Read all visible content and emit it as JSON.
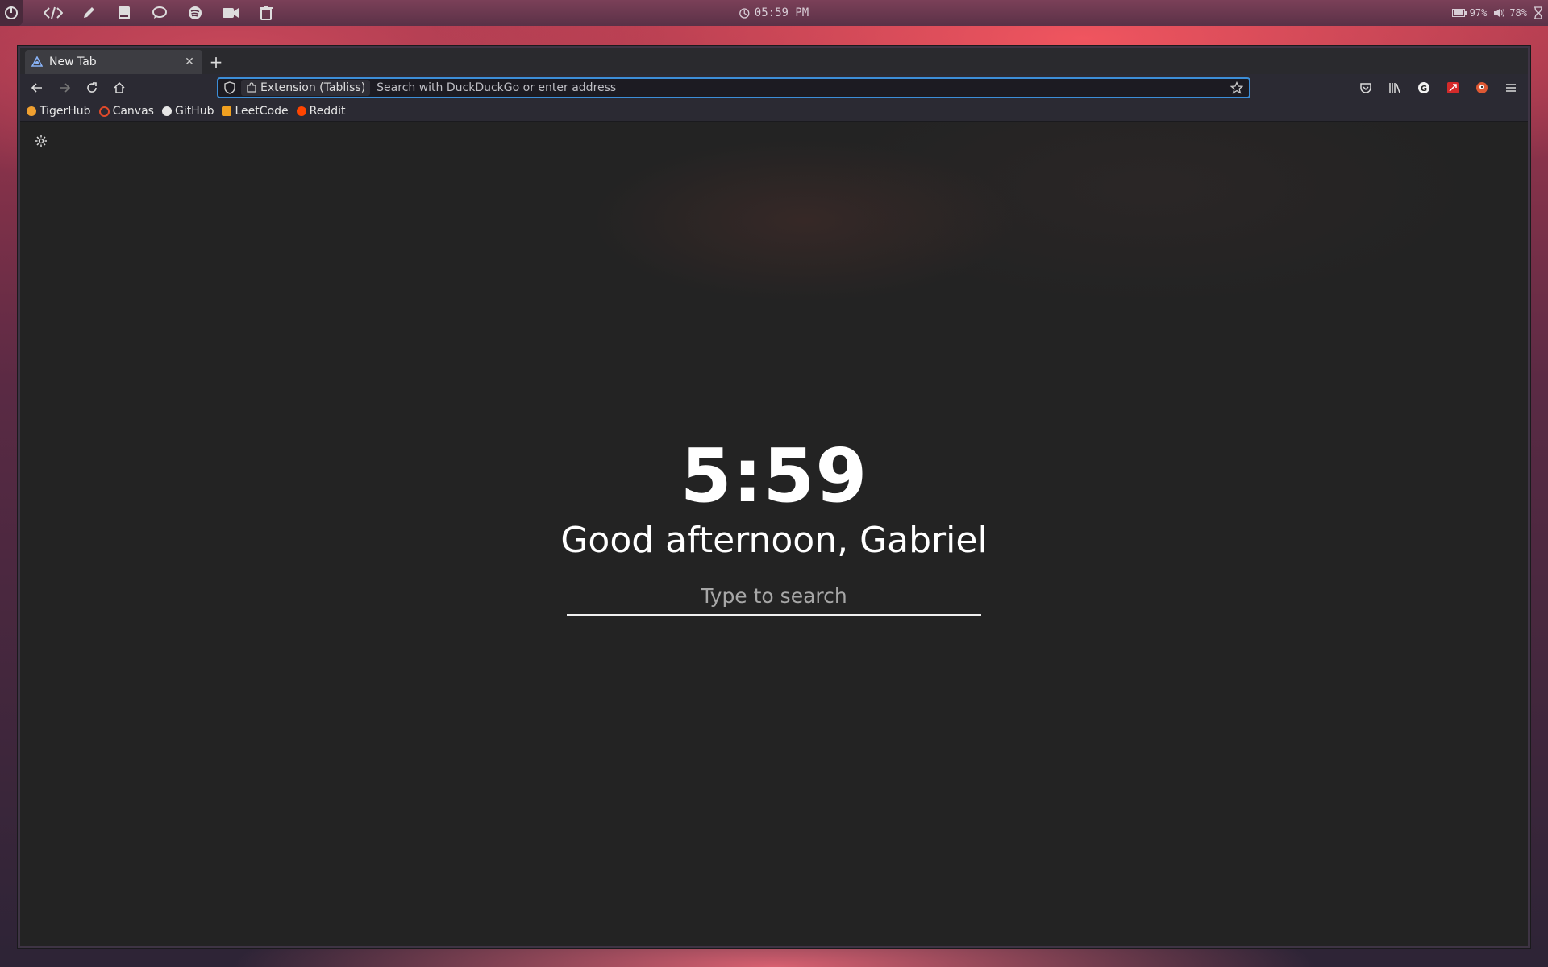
{
  "system_panel": {
    "apps": [
      "launcher",
      "code-editor",
      "pencil",
      "notes",
      "chat",
      "spotify",
      "video",
      "trash"
    ],
    "clock": "05:59 PM",
    "battery": "97%",
    "volume": "78%"
  },
  "browser": {
    "tab": {
      "title": "New Tab"
    },
    "new_tab_symbol": "+",
    "urlbar": {
      "extension_chip": "Extension (Tabliss)",
      "placeholder": "Search with DuckDuckGo or enter address"
    },
    "bookmarks": [
      {
        "label": "TigerHub",
        "color": "#f0a030"
      },
      {
        "label": "Canvas",
        "color": "#e04a2a"
      },
      {
        "label": "GitHub",
        "color": "#e6e6e6"
      },
      {
        "label": "LeetCode",
        "color": "#f0a020"
      },
      {
        "label": "Reddit",
        "color": "#ff4500"
      }
    ],
    "toolbar_right": [
      "pocket",
      "library",
      "grammarly",
      "extension-red",
      "duckduckgo",
      "menu"
    ]
  },
  "newtab": {
    "time": "5:59",
    "greeting": "Good afternoon, Gabriel",
    "search_placeholder": "Type to search"
  },
  "colors": {
    "accent": "#3c8ed8",
    "content_bg": "#232323"
  }
}
